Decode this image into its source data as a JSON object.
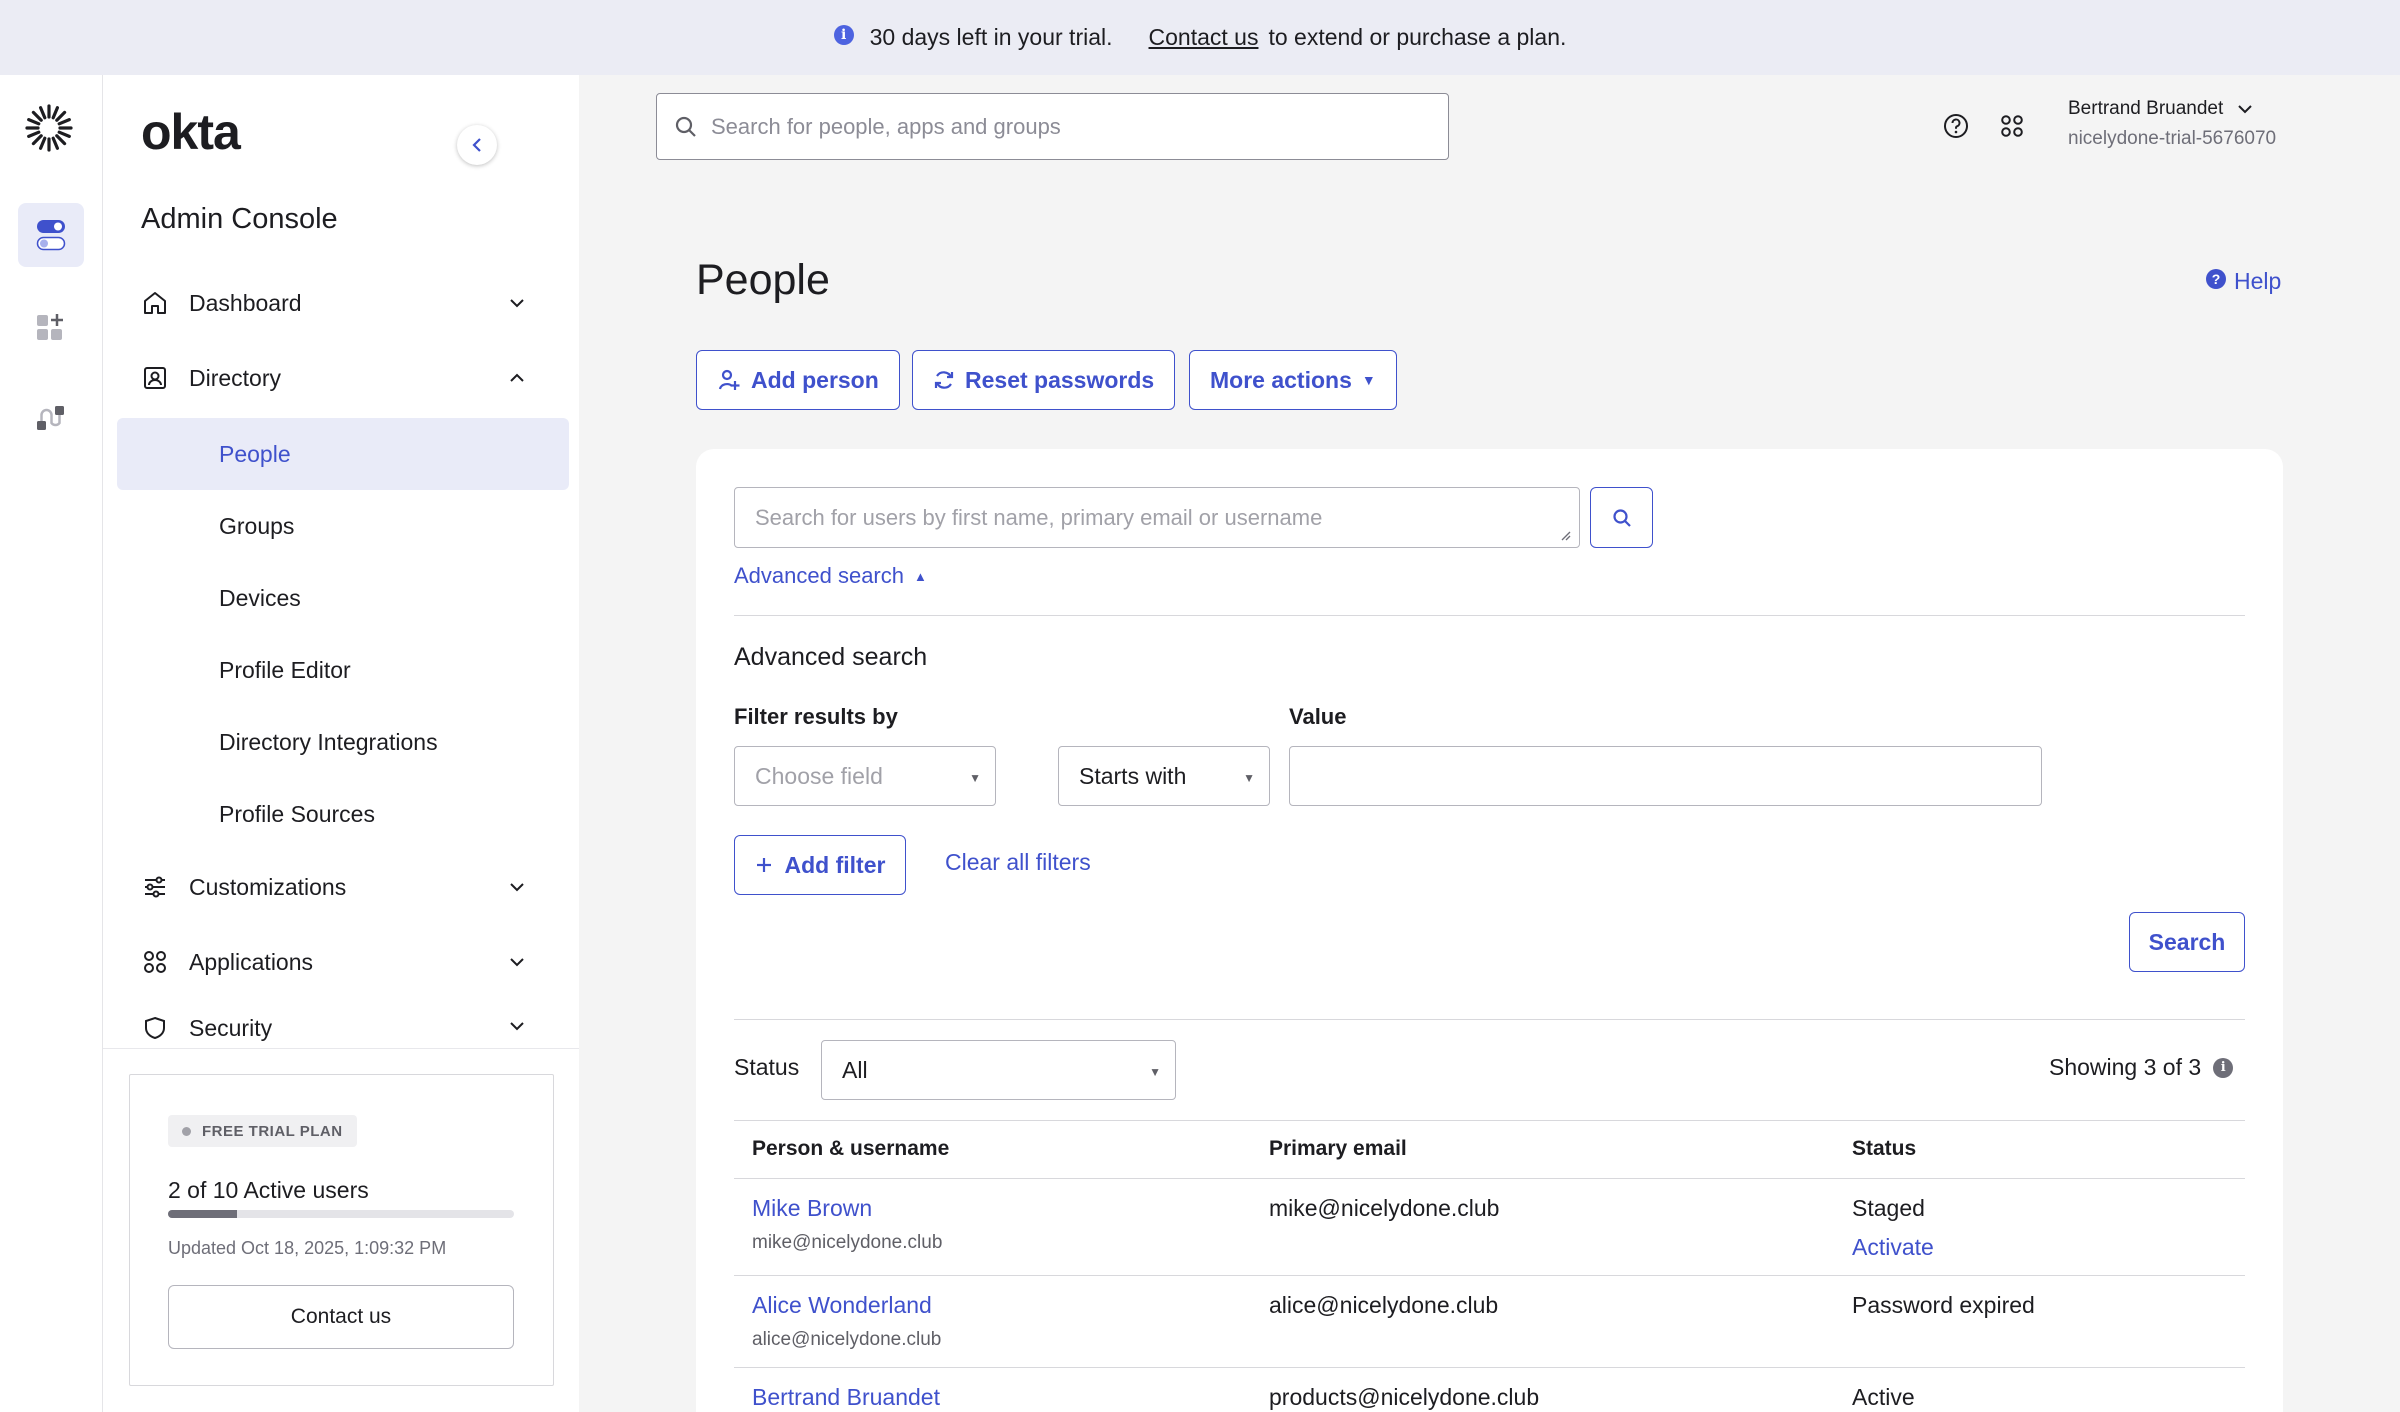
{
  "banner": {
    "info_icon": "info-icon",
    "trial_text": "30 days left in your trial.",
    "contact_link": "Contact us",
    "suffix": "to extend or purchase a plan."
  },
  "rail": {
    "logo_icon": "okta-burst-logo",
    "items": [
      {
        "icon": "toggle-switches-icon",
        "active": true
      },
      {
        "icon": "add-apps-icon",
        "active": false
      },
      {
        "icon": "workflow-connector-icon",
        "active": false
      }
    ]
  },
  "sidebar": {
    "brand": "okta",
    "console_title": "Admin Console",
    "nav": {
      "dashboard": "Dashboard",
      "directory": "Directory",
      "customizations": "Customizations",
      "applications": "Applications",
      "security": "Security"
    },
    "directory_items": {
      "people": "People",
      "groups": "Groups",
      "devices": "Devices",
      "profile_editor": "Profile Editor",
      "directory_integrations": "Directory Integrations",
      "profile_sources": "Profile Sources"
    },
    "trial": {
      "badge": "FREE TRIAL PLAN",
      "users": "2 of 10 Active users",
      "usage_fraction": 0.2,
      "updated": "Updated Oct 18, 2025, 1:09:32 PM",
      "contact_button": "Contact us"
    }
  },
  "topbar": {
    "search_placeholder": "Search for people, apps and groups",
    "user_name": "Bertrand Bruandet",
    "org": "nicelydone-trial-5676070"
  },
  "page": {
    "title": "People",
    "help": "Help",
    "actions": {
      "add_person": "Add person",
      "reset_passwords": "Reset passwords",
      "more_actions": "More actions"
    }
  },
  "search": {
    "placeholder": "Search for users by first name, primary email or username",
    "advanced_toggle": "Advanced search",
    "advanced_title": "Advanced search",
    "filter_label": "Filter results by",
    "value_label": "Value",
    "field_placeholder": "Choose field",
    "operator": "Starts with",
    "value": "",
    "add_filter": "Add filter",
    "clear_filters": "Clear all filters",
    "search_button": "Search"
  },
  "results": {
    "status_label": "Status",
    "status_value": "All",
    "showing": "Showing 3 of 3",
    "columns": {
      "person": "Person & username",
      "email": "Primary email",
      "status": "Status"
    },
    "rows": [
      {
        "name": "Mike Brown",
        "username": "mike@nicelydone.club",
        "email": "mike@nicelydone.club",
        "status": "Staged",
        "action": "Activate"
      },
      {
        "name": "Alice Wonderland",
        "username": "alice@nicelydone.club",
        "email": "alice@nicelydone.club",
        "status": "Password expired",
        "action": ""
      },
      {
        "name": "Bertrand Bruandet",
        "username": "",
        "email": "products@nicelydone.club",
        "status": "Active",
        "action": ""
      }
    ]
  },
  "colors": {
    "accent": "#3f51cc",
    "banner_bg": "#ebecf4",
    "active_nav_bg": "#e9ebf8",
    "page_bg": "#f4f4f4"
  }
}
